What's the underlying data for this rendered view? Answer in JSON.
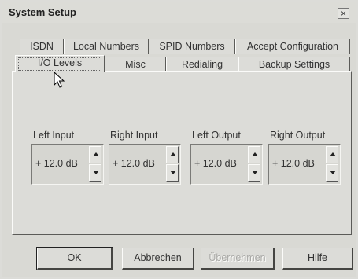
{
  "window": {
    "title": "System Setup",
    "close_glyph": "×"
  },
  "tabs": {
    "row_top": [
      "ISDN",
      "Local Numbers",
      "SPID Numbers",
      "Accept Configuration"
    ],
    "row_bottom": [
      "I/O Levels",
      "Misc",
      "Redialing",
      "Backup Settings"
    ],
    "active": "I/O Levels"
  },
  "levels": [
    {
      "label": "Left Input",
      "value": "+ 12.0 dB"
    },
    {
      "label": "Right Input",
      "value": "+ 12.0 dB"
    },
    {
      "label": "Left Output",
      "value": "+ 12.0 dB"
    },
    {
      "label": "Right Output",
      "value": "+ 12.0 dB"
    }
  ],
  "buttons": {
    "ok": "OK",
    "cancel": "Abbrechen",
    "apply": "Übernehmen",
    "help": "Hilfe"
  },
  "icons": {
    "close": "close-icon",
    "cursor": "mouse-pointer-icon"
  }
}
